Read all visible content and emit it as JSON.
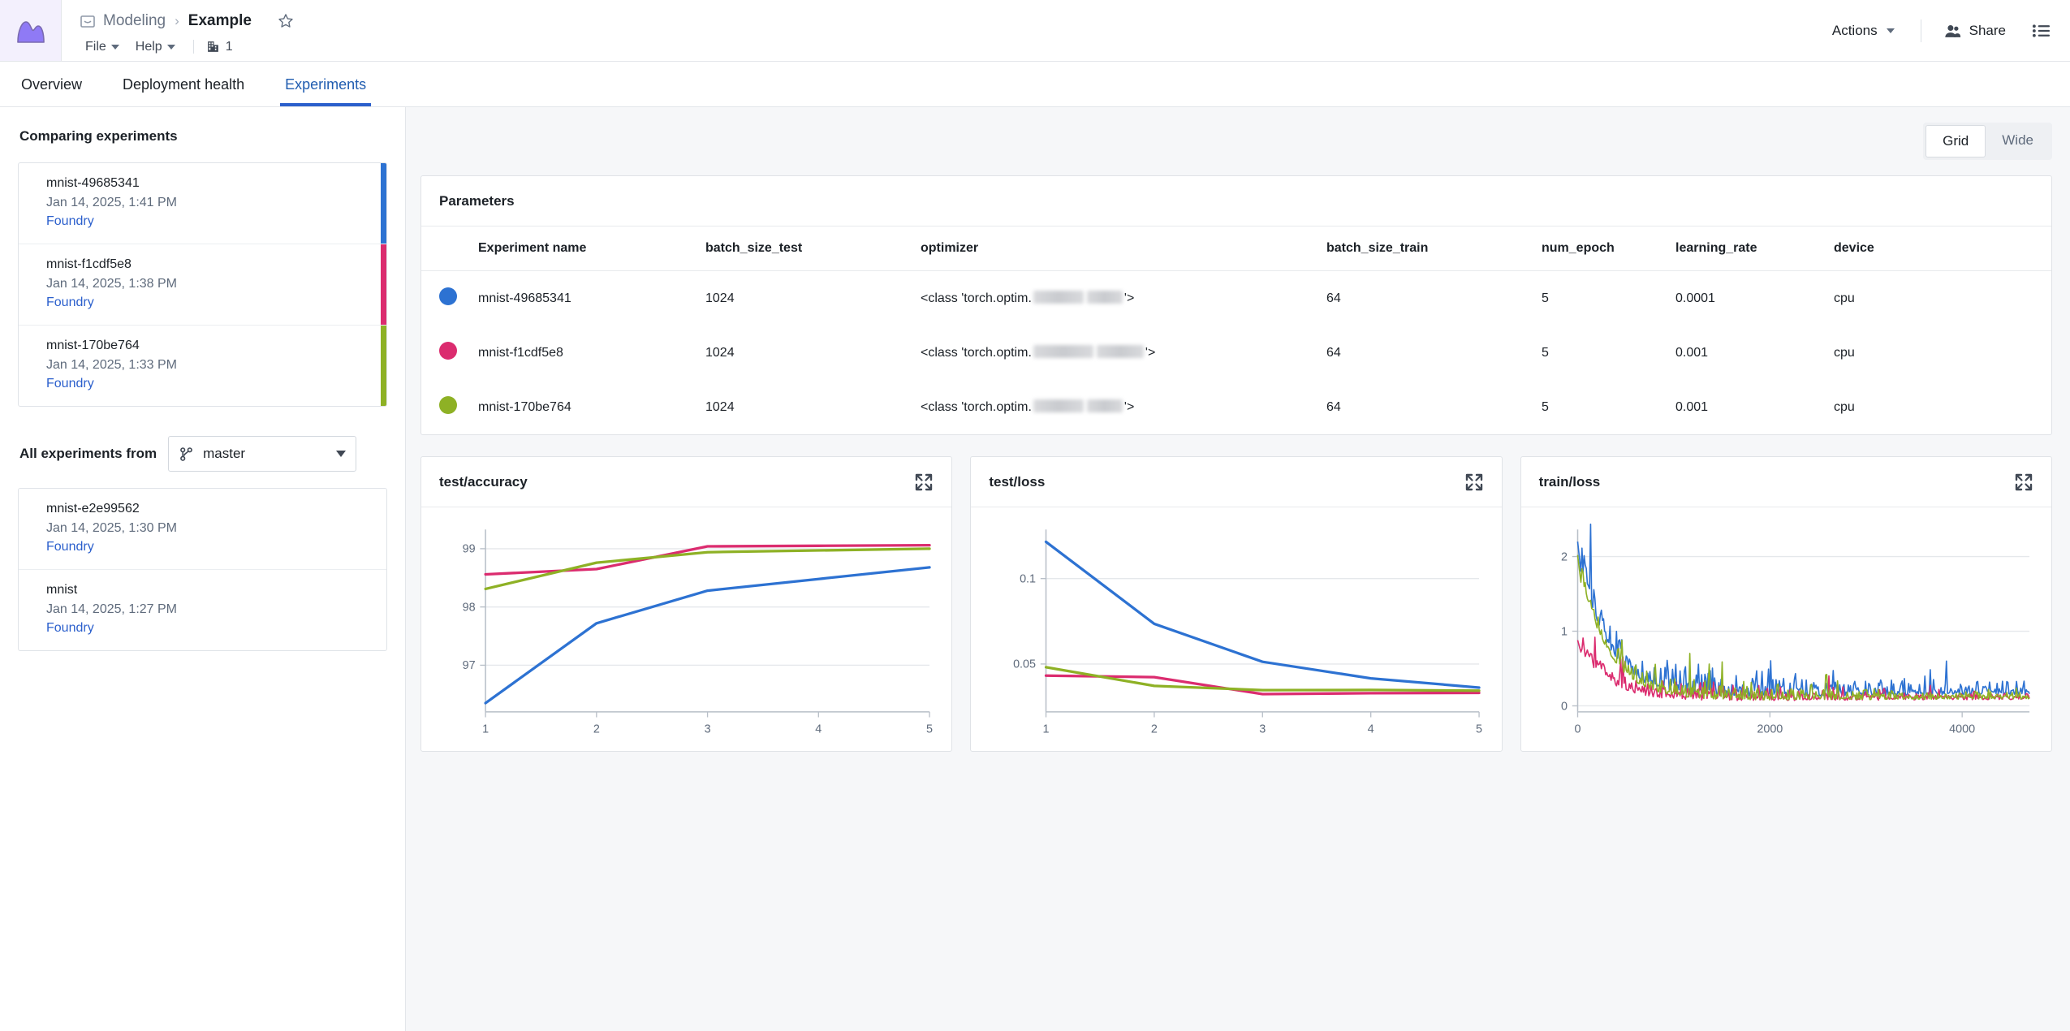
{
  "topbar": {
    "logo_name": "foundry-logo",
    "breadcrumb_icon": "folder-icon",
    "breadcrumb_parent": "Modeling",
    "breadcrumb_separator": "›",
    "breadcrumb_current": "Example",
    "star_icon": "star-icon",
    "menu": [
      {
        "label": "File",
        "icon": "chevron-down-icon"
      },
      {
        "label": "Help",
        "icon": "chevron-down-icon"
      }
    ],
    "org": {
      "icon": "building-icon",
      "count": "1"
    },
    "actions_label": "Actions",
    "actions_icon": "chevron-down-icon",
    "share_label": "Share",
    "share_icon": "people-icon",
    "list_icon": "list-icon"
  },
  "tabs": [
    {
      "label": "Overview",
      "active": false
    },
    {
      "label": "Deployment health",
      "active": false
    },
    {
      "label": "Experiments",
      "active": true
    }
  ],
  "sidebar": {
    "comparing_heading": "Comparing experiments",
    "comparing": [
      {
        "name": "mnist-49685341",
        "date": "Jan 14, 2025, 1:41 PM",
        "source": "Foundry",
        "color": "#2d72d2"
      },
      {
        "name": "mnist-f1cdf5e8",
        "date": "Jan 14, 2025, 1:38 PM",
        "source": "Foundry",
        "color": "#db2c6f"
      },
      {
        "name": "mnist-170be764",
        "date": "Jan 14, 2025, 1:33 PM",
        "source": "Foundry",
        "color": "#8eb125"
      }
    ],
    "all_experiments_label": "All experiments from",
    "branch_icon": "git-branch-icon",
    "branch_value": "master",
    "branch_caret_icon": "chevron-down-icon",
    "all_experiments": [
      {
        "name": "mnist-e2e99562",
        "date": "Jan 14, 2025, 1:30 PM",
        "source": "Foundry"
      },
      {
        "name": "mnist",
        "date": "Jan 14, 2025, 1:27 PM",
        "source": "Foundry"
      }
    ]
  },
  "main": {
    "view_toggle": [
      {
        "label": "Grid",
        "active": true
      },
      {
        "label": "Wide",
        "active": false
      }
    ],
    "parameters": {
      "title": "Parameters",
      "columns": [
        "Experiment name",
        "batch_size_test",
        "optimizer",
        "batch_size_train",
        "num_epoch",
        "learning_rate",
        "device"
      ],
      "rows": [
        {
          "color": "#2d72d2",
          "name": "mnist-49685341",
          "batch_size_test": "1024",
          "optimizer_prefix": "<class 'torch.optim.",
          "optimizer_suffix": "'>",
          "batch_size_train": "64",
          "num_epoch": "5",
          "learning_rate": "0.0001",
          "device": "cpu"
        },
        {
          "color": "#db2c6f",
          "name": "mnist-f1cdf5e8",
          "batch_size_test": "1024",
          "optimizer_prefix": "<class 'torch.optim.",
          "optimizer_suffix": "'>",
          "batch_size_train": "64",
          "num_epoch": "5",
          "learning_rate": "0.001",
          "device": "cpu"
        },
        {
          "color": "#8eb125",
          "name": "mnist-170be764",
          "batch_size_test": "1024",
          "optimizer_prefix": "<class 'torch.optim.",
          "optimizer_suffix": "'>",
          "batch_size_train": "64",
          "num_epoch": "5",
          "learning_rate": "0.001",
          "device": "cpu"
        }
      ]
    },
    "charts": [
      {
        "title": "test/accuracy",
        "expand_icon": "expand-icon"
      },
      {
        "title": "test/loss",
        "expand_icon": "expand-icon"
      },
      {
        "title": "train/loss",
        "expand_icon": "expand-icon"
      }
    ]
  },
  "chart_data": [
    {
      "type": "line",
      "title": "test/accuracy",
      "xlabel": "",
      "ylabel": "",
      "x": [
        1,
        2,
        3,
        4,
        5
      ],
      "xticks": [
        "1",
        "2",
        "3",
        "4",
        "5"
      ],
      "yticks": [
        "97",
        "98",
        "99"
      ],
      "ylim": [
        96.2,
        99.25
      ],
      "xlim": [
        1,
        5
      ],
      "grid": true,
      "legend": "none",
      "series": [
        {
          "name": "mnist-49685341",
          "color": "#2d72d2",
          "values": [
            96.35,
            97.72,
            98.28,
            98.48,
            98.68
          ]
        },
        {
          "name": "mnist-f1cdf5e8",
          "color": "#db2c6f",
          "values": [
            98.56,
            98.65,
            99.04,
            99.05,
            99.06
          ]
        },
        {
          "name": "mnist-170be764",
          "color": "#8eb125",
          "values": [
            98.31,
            98.76,
            98.94,
            98.97,
            99.0
          ]
        }
      ]
    },
    {
      "type": "line",
      "title": "test/loss",
      "xlabel": "",
      "ylabel": "",
      "x": [
        1,
        2,
        3,
        4,
        5
      ],
      "xticks": [
        "1",
        "2",
        "3",
        "4",
        "5"
      ],
      "yticks": [
        "0.05",
        "0.1"
      ],
      "ylim": [
        0.022,
        0.126
      ],
      "xlim": [
        1,
        5
      ],
      "grid": true,
      "legend": "none",
      "series": [
        {
          "name": "mnist-49685341",
          "color": "#2d72d2",
          "values": [
            0.1215,
            0.0735,
            0.0513,
            0.0416,
            0.0362
          ]
        },
        {
          "name": "mnist-f1cdf5e8",
          "color": "#db2c6f",
          "values": [
            0.0432,
            0.0423,
            0.0324,
            0.0329,
            0.0331
          ]
        },
        {
          "name": "mnist-170be764",
          "color": "#8eb125",
          "values": [
            0.0481,
            0.0372,
            0.0347,
            0.0348,
            0.0344
          ]
        }
      ]
    },
    {
      "type": "line",
      "title": "train/loss",
      "xlabel": "",
      "ylabel": "",
      "xticks": [
        "0",
        "2000",
        "4000"
      ],
      "yticks": [
        "0",
        "1",
        "2"
      ],
      "ylim": [
        -0.08,
        2.3
      ],
      "xlim": [
        0,
        4700
      ],
      "grid": true,
      "legend": "none",
      "note": "noisy per-step training loss; sharp decay from ~2.2 to ~0.1 within first ~300 steps then noisy plateau near 0-0.3",
      "series": [
        {
          "name": "mnist-49685341",
          "color": "#2d72d2",
          "start": 2.2,
          "plateau": 0.18,
          "decay_steps": 300
        },
        {
          "name": "mnist-f1cdf5e8",
          "color": "#db2c6f",
          "start": 0.88,
          "plateau": 0.1,
          "decay_steps": 300
        },
        {
          "name": "mnist-170be764",
          "color": "#8eb125",
          "start": 2.02,
          "plateau": 0.11,
          "decay_steps": 300
        }
      ]
    }
  ]
}
